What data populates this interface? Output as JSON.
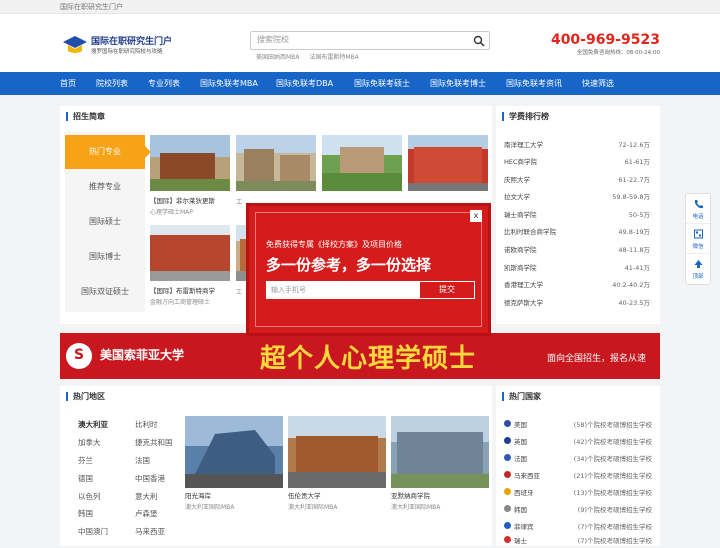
{
  "topbar": {
    "text": "国际在职研究生门户"
  },
  "logo": {
    "title": "国际在职研究生门户",
    "subtitle": "搜罗国际在职研究院校与攻略"
  },
  "search": {
    "placeholder": "搜索院校",
    "hotwords": [
      "美国田纳西MBA",
      "法国布雷斯特MBA"
    ]
  },
  "contact": {
    "phone": "400-969-9523",
    "hours": "全国免费咨询热线：08:00-24:00"
  },
  "nav": [
    "首页",
    "院校列表",
    "专业列表",
    "国际免联考MBA",
    "国际免联考DBA",
    "国际免联考硕士",
    "国际免联考博士",
    "国际免联考资讯",
    "快速筛选"
  ],
  "admissions": {
    "title": "招生简章",
    "tabs": [
      "热门专业",
      "推荐专业",
      "国际硕士",
      "国际博士",
      "国际双证硕士"
    ],
    "cards": [
      {
        "title": "【国际】菲尔莱狄更斯",
        "sub": "心理学硕士MAP"
      },
      {
        "title": "",
        "sub": "工"
      },
      {
        "title": "",
        "sub": ""
      },
      {
        "title": "",
        "sub": ""
      },
      {
        "title": "【国际】布雷斯特商学",
        "sub": "金融方向工商管理硕士"
      },
      {
        "title": "",
        "sub": "工"
      }
    ]
  },
  "ranking": {
    "title": "学费排行榜",
    "rows": [
      {
        "name": "南洋理工大学",
        "value": "72-12.6万"
      },
      {
        "name": "HEC商学院",
        "value": "61-61万"
      },
      {
        "name": "庆熙大学",
        "value": "61-22.7万"
      },
      {
        "name": "拉文大学",
        "value": "59.8-59.8万"
      },
      {
        "name": "瑞士商学院",
        "value": "50-5万"
      },
      {
        "name": "比利时联合商学院",
        "value": "49.8-19万"
      },
      {
        "name": "诺欧商学院",
        "value": "48-11.8万"
      },
      {
        "name": "凯斯商学院",
        "value": "41-41万"
      },
      {
        "name": "香港理工大学",
        "value": "40.2-40.2万"
      },
      {
        "name": "德克萨斯大学",
        "value": "40-23.5万"
      }
    ]
  },
  "popup": {
    "close": "x",
    "line1": "免费获得专属《择校方案》及项目价格",
    "line2": "多一份参考，多一份选择",
    "placeholder": "输入手机号",
    "submit": "提交"
  },
  "banner": {
    "logo_letter": "S",
    "university": "美国索菲亚大学",
    "headline": "超个人心理学硕士",
    "tagline": "面向全国招生，报名从速"
  },
  "regions": {
    "title": "热门地区",
    "items": [
      "澳大利亚",
      "比利时",
      "加拿大",
      "捷克共和国",
      "芬兰",
      "法国",
      "德国",
      "中国香港",
      "以色列",
      "意大利",
      "韩国",
      "卢森堡",
      "中国澳门",
      "马来西亚"
    ],
    "cards": [
      {
        "title": "阳光海岸",
        "sub": "澳大利亚国际MBA"
      },
      {
        "title": "伍伦贡大学",
        "sub": "澳大利亚国际MBA"
      },
      {
        "title": "亚默纳商学院",
        "sub": "澳大利亚国际MBA"
      }
    ]
  },
  "countries": {
    "title": "热门国家",
    "rows": [
      {
        "name": "美国",
        "count": "(58)个院校考硕博招生学校",
        "color": "#2b4fa5"
      },
      {
        "name": "英国",
        "count": "(42)个院校考硕博招生学校",
        "color": "#1f3f8c"
      },
      {
        "name": "法国",
        "count": "(34)个院校考硕博招生学校",
        "color": "#2d58b5"
      },
      {
        "name": "马来西亚",
        "count": "(21)个院校考硕博招生学校",
        "color": "#c62828"
      },
      {
        "name": "西班牙",
        "count": "(13)个院校考硕博招生学校",
        "color": "#e6a400"
      },
      {
        "name": "韩国",
        "count": "(9)个院校考硕博招生学校",
        "color": "#888888"
      },
      {
        "name": "菲律宾",
        "count": "(7)个院校考硕博招生学校",
        "color": "#1f5fbf"
      },
      {
        "name": "瑞士",
        "count": "(7)个院校考硕博招生学校",
        "color": "#d32f2f"
      }
    ]
  },
  "side_tools": [
    "电话",
    "微信",
    "顶部"
  ]
}
